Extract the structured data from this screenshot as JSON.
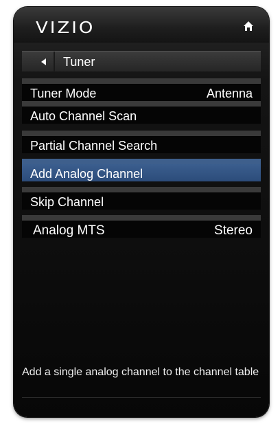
{
  "header": {
    "logo": "VIZIO",
    "home_icon": "home-icon"
  },
  "nav": {
    "back_icon": "back-arrow-icon",
    "title": "Tuner"
  },
  "menu": {
    "items": [
      {
        "label": "Tuner Mode",
        "value": "Antenna"
      },
      {
        "label": "Auto Channel Scan",
        "value": ""
      },
      {
        "label": "Partial Channel Search",
        "value": ""
      },
      {
        "label": "Add Analog Channel",
        "value": ""
      },
      {
        "label": "Skip Channel",
        "value": ""
      },
      {
        "label": "Analog MTS",
        "value": "Stereo"
      }
    ],
    "selected_index": 3
  },
  "description": "Add a single analog channel to the channel table",
  "colors": {
    "selected_bg": "#3b5e8e",
    "panel_bg": "#070707",
    "separator": "#3a3a3a"
  }
}
